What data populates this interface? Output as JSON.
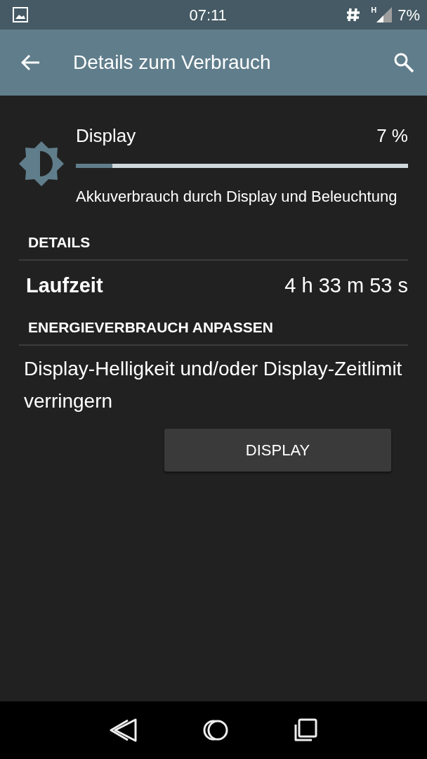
{
  "status_bar": {
    "time": "07:11",
    "network_type": "H",
    "battery": "7%"
  },
  "app_bar": {
    "title": "Details zum Verbrauch"
  },
  "usage": {
    "name": "Display",
    "percent": "7 %",
    "level": 0.11,
    "description": "Akkuverbrauch durch Display und Beleuchtung"
  },
  "details": {
    "header": "DETAILS",
    "rows": [
      {
        "label": "Laufzeit",
        "value": "4 h 33 m 53 s"
      }
    ]
  },
  "adjust": {
    "header": "ENERGIEVERBRAUCH ANPASSEN",
    "text": "Display-Helligkeit und/oder Display-Zeitlimit verringern",
    "button": "DISPLAY"
  }
}
